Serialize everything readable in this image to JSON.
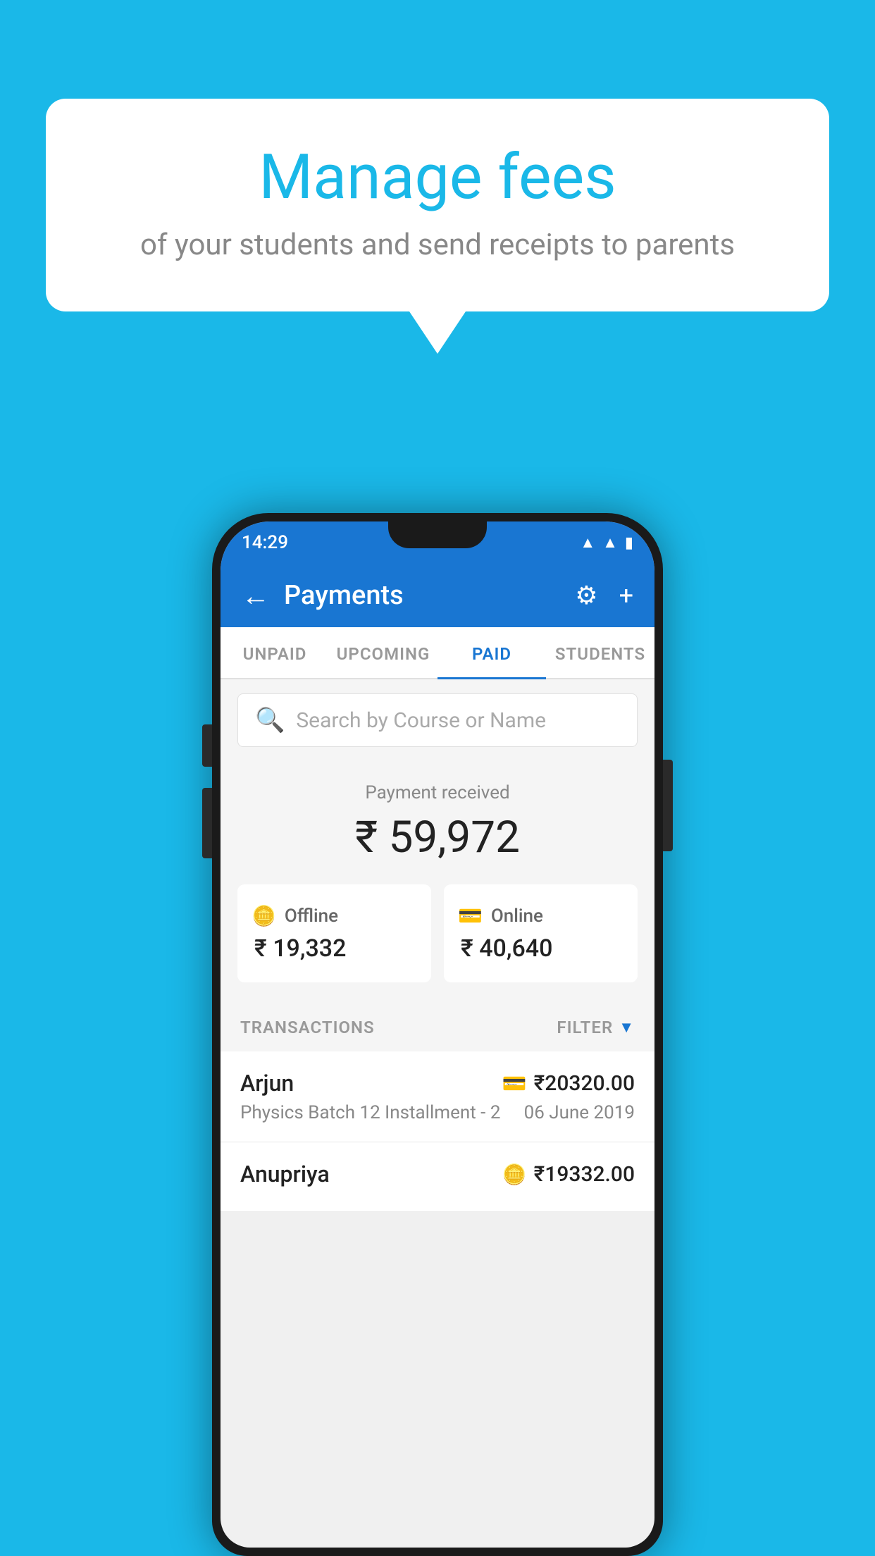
{
  "background_color": "#1ab8e8",
  "speech_bubble": {
    "title": "Manage fees",
    "subtitle": "of your students and send receipts to parents"
  },
  "status_bar": {
    "time": "14:29",
    "icons": [
      "wifi",
      "signal",
      "battery"
    ]
  },
  "app_bar": {
    "title": "Payments",
    "back_label": "←",
    "settings_label": "⚙",
    "add_label": "+"
  },
  "tabs": [
    {
      "label": "UNPAID",
      "active": false
    },
    {
      "label": "UPCOMING",
      "active": false
    },
    {
      "label": "PAID",
      "active": true
    },
    {
      "label": "STUDENTS",
      "active": false
    }
  ],
  "search": {
    "placeholder": "Search by Course or Name"
  },
  "payment_summary": {
    "label": "Payment received",
    "amount": "₹ 59,972",
    "offline": {
      "type": "Offline",
      "amount": "₹ 19,332"
    },
    "online": {
      "type": "Online",
      "amount": "₹ 40,640"
    }
  },
  "transactions_section": {
    "label": "TRANSACTIONS",
    "filter_label": "FILTER"
  },
  "transactions": [
    {
      "name": "Arjun",
      "amount": "₹20320.00",
      "course": "Physics Batch 12 Installment - 2",
      "date": "06 June 2019",
      "payment_type": "online"
    },
    {
      "name": "Anupriya",
      "amount": "₹19332.00",
      "course": "",
      "date": "",
      "payment_type": "offline"
    }
  ]
}
